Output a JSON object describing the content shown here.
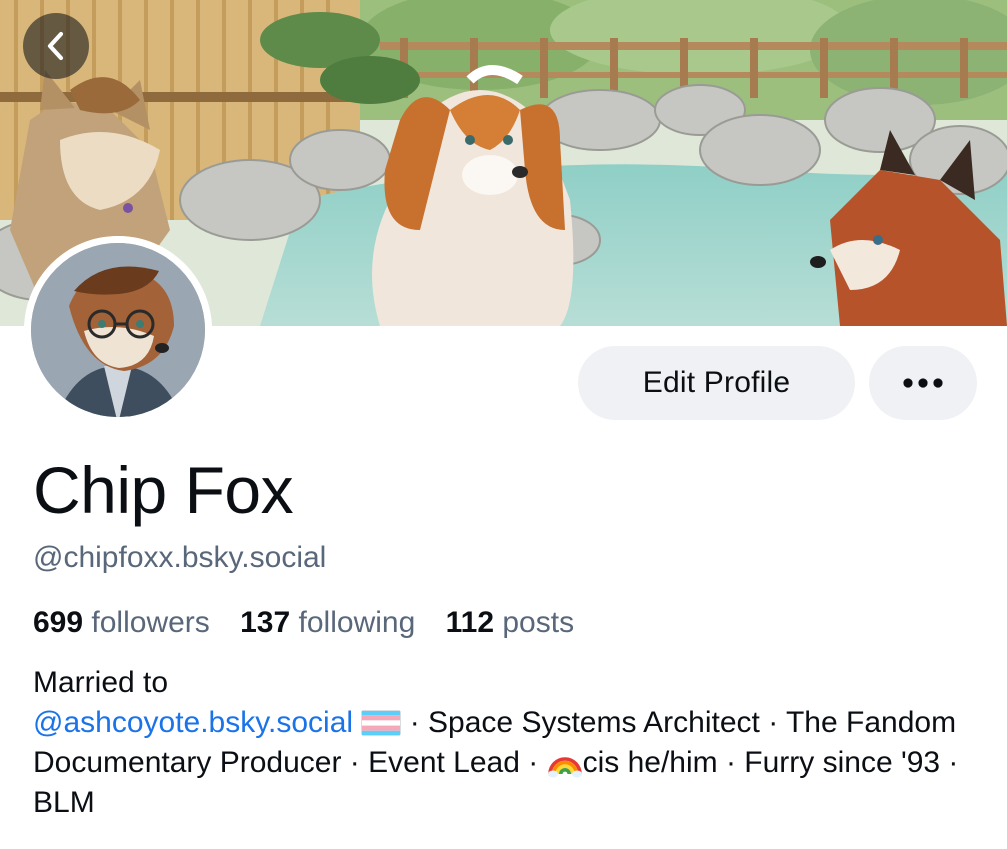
{
  "header": {
    "back_icon": "chevron-left-icon"
  },
  "profile": {
    "display_name": "Chip Fox",
    "handle": "@chipfoxx.bsky.social",
    "edit_button_label": "Edit Profile",
    "more_icon": "more-horizontal-icon"
  },
  "stats": {
    "followers_count": "699",
    "followers_label": "followers",
    "following_count": "137",
    "following_label": "following",
    "posts_count": "112",
    "posts_label": "posts"
  },
  "bio": {
    "line_intro": "Married to",
    "mention": "@ashcoyote.bsky.social",
    "flag_icon": "transgender-flag-icon",
    "text_part_1": " · Space Systems Architect · The Fandom Documentary Producer · Event Lead · ",
    "rainbow_icon": "rainbow-icon",
    "text_part_2": "cis he/him · Furry since '93 · BLM"
  },
  "colors": {
    "link": "#1a73e8",
    "muted_text": "#59677a",
    "button_bg": "#eff1f4"
  }
}
